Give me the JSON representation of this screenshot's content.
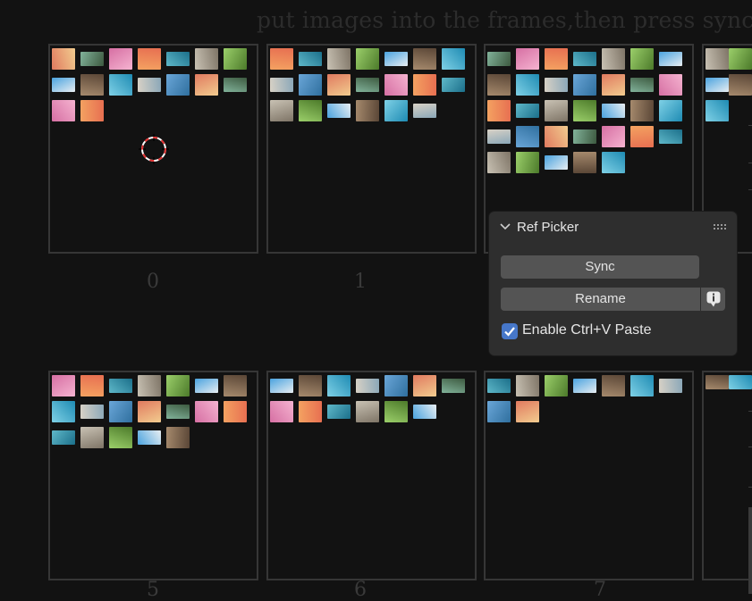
{
  "instruction": "put images into the frames,then press sync",
  "frame_labels": [
    "0",
    "1",
    "5",
    "6",
    "7"
  ],
  "panel": {
    "title": "Ref Picker",
    "sync_label": "Sync",
    "rename_label": "Rename",
    "checkbox_label": "Enable Ctrl+V Paste",
    "checkbox_checked": true
  },
  "colors": {
    "background": "#121212",
    "frame_border": "#363636",
    "panel_bg": "#2e2e2e",
    "button_bg": "#545454",
    "checkbox_accent": "#4677c9",
    "cursor_red": "#e03030"
  }
}
